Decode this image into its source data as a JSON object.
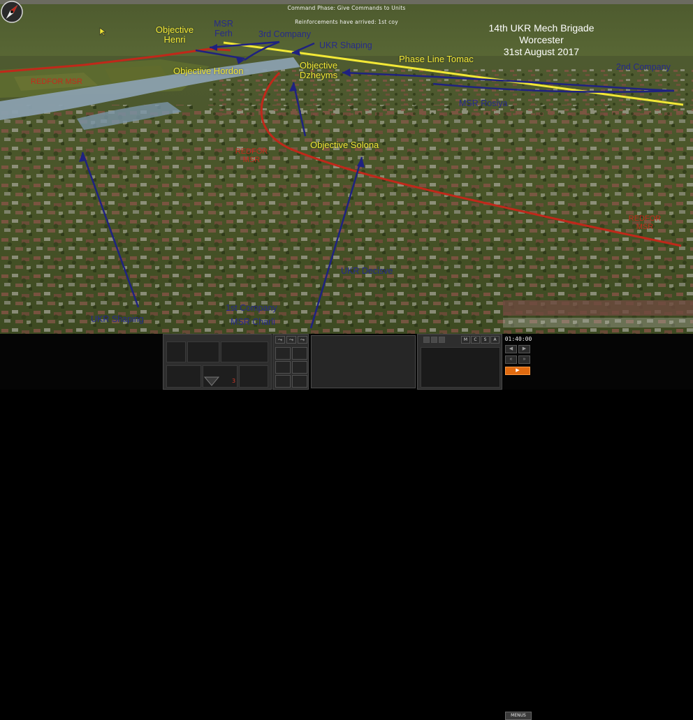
{
  "messages": {
    "phase": "Command Phase: Give Commands to Units",
    "reinforcements": "Reinforcements have arrived: 1st coy"
  },
  "header": {
    "line1": "14th UKR Mech Brigade",
    "line2": "Worcester",
    "line3": "31st August 2017"
  },
  "objectives": {
    "henri_1": "Objective",
    "henri_2": "Henri",
    "hordon": "Objective Hordon",
    "dzheyms_1": "Objective",
    "dzheyms_2": "Dzheyms",
    "solona": "Objective Solona"
  },
  "phase_line": "Phase Line Tomac",
  "routes": {
    "msr_ferh_1": "MSR",
    "msr_ferh_2": "Ferh",
    "third_company": "3rd Company",
    "ukr_shaping_top": "UKR Shaping",
    "second_company": "2nd Company",
    "msr_rosiya": "MSR Rosiya",
    "ukr_decisive": "UKR Decisve",
    "first_company": "1st Company",
    "msr_charli": "MSR Charli",
    "ukr_shaping_bottom": "UKR Shaping"
  },
  "redfor": {
    "msr_left": "REDFOR MSR",
    "msr_center_1": "REDFOR",
    "msr_center_2": "MSR",
    "msr_right_1": "REDFOR",
    "msr_right_2": "MSR"
  },
  "hud": {
    "clock": "01:40:00",
    "menus": "MENUS",
    "tabs": [
      "M",
      "C",
      "S",
      "A"
    ],
    "alert_count": "3"
  },
  "colors": {
    "redfor_line": "#c0281a",
    "arrow_blue": "#1f2280",
    "phase_line": "#f2e836",
    "accent_orange": "#e06a10"
  },
  "icons": {
    "compass": "compass-rose-icon",
    "cursor": "mouse-pointer-icon"
  }
}
